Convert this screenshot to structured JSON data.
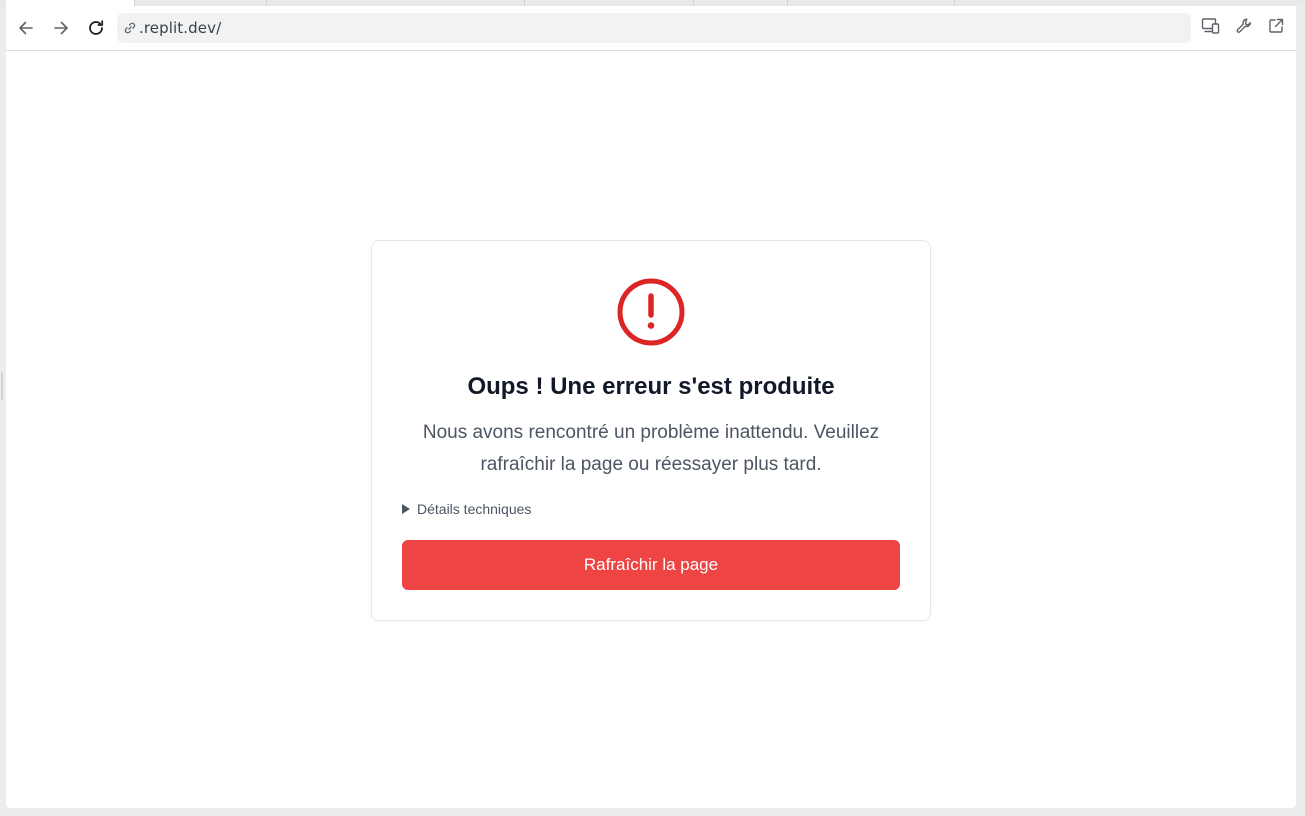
{
  "browser": {
    "url": ".replit.dev/",
    "icons": {
      "back": "arrow-left-icon",
      "forward": "arrow-right-icon",
      "reload": "reload-icon",
      "link": "link-icon",
      "devices": "devices-icon",
      "devtools": "wrench-icon",
      "open_external": "external-link-icon"
    }
  },
  "error_card": {
    "icon": "alert-circle-icon",
    "title": "Oups ! Une erreur s'est produite",
    "message": "Nous avons rencontré un problème inattendu. Veuillez rafraîchir la page ou réessayer plus tard.",
    "details_label": "Détails techniques",
    "button_label": "Rafraîchir la page"
  },
  "colors": {
    "accent_red": "#ef4444",
    "icon_red": "#dc2626",
    "title_text": "#111827",
    "body_text": "#4b5563"
  }
}
